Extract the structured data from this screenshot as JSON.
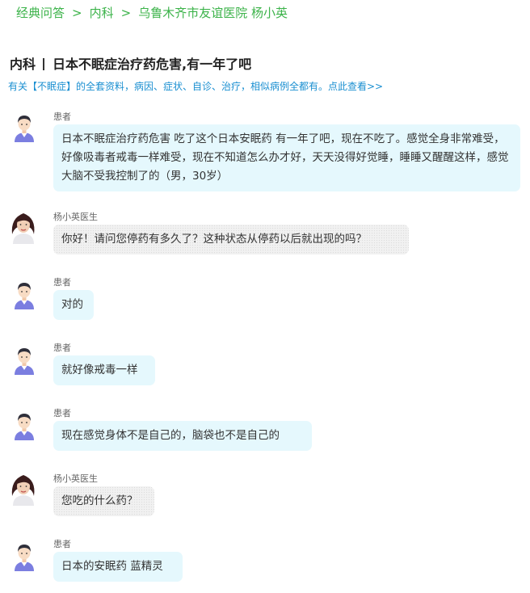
{
  "breadcrumb": {
    "items": [
      "经典问答",
      "内科",
      "乌鲁木齐市友谊医院 杨小英"
    ],
    "separator": ">"
  },
  "header": {
    "department": "内科",
    "question_title": "日本不眠症治疗药危害,有一年了吧"
  },
  "promo_link": "有关【不眠症】的全套资料，病因、症状、自诊、治疗，相似病例全都有。点此查看>>",
  "messages": [
    {
      "role": "patient",
      "sender": "患者",
      "text": "日本不眠症治疗药危害 吃了这个日本安眠药 有一年了吧，现在不吃了。感觉全身非常难受，好像吸毒者戒毒一样难受，现在不知道怎么办才好，天天没得好觉睡，睡睡又醒醒这样，感觉大脑不受我控制了的（男，30岁）"
    },
    {
      "role": "doctor",
      "sender": "杨小英医生",
      "text": "你好！请问您停药有多久了？这种状态从停药以后就出现的吗？"
    },
    {
      "role": "patient",
      "sender": "患者",
      "text": "对的"
    },
    {
      "role": "patient",
      "sender": "患者",
      "text": "就好像戒毒一样"
    },
    {
      "role": "patient",
      "sender": "患者",
      "text": "现在感觉身体不是自己的，脑袋也不是自己的"
    },
    {
      "role": "doctor",
      "sender": "杨小英医生",
      "text": "您吃的什么药？"
    },
    {
      "role": "patient",
      "sender": "患者",
      "text": "日本的安眠药 蓝精灵"
    }
  ],
  "colors": {
    "breadcrumb_green": "#3cb34a",
    "promo_blue": "#1a8fd1",
    "patient_bubble": "#e5f8fd",
    "doctor_bubble": "#f1f1f1"
  }
}
